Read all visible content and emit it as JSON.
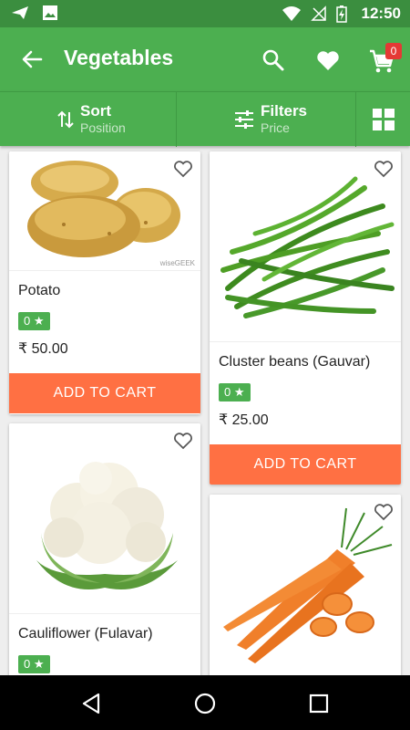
{
  "status_bar": {
    "time": "12:50"
  },
  "app_bar": {
    "title": "Vegetables",
    "cart_count": "0"
  },
  "filter_bar": {
    "sort": {
      "label": "Sort",
      "value": "Position"
    },
    "filters": {
      "label": "Filters",
      "value": "Price"
    }
  },
  "products": [
    {
      "name": "Potato",
      "rating": "0 ★",
      "price": "₹ 50.00",
      "add_label": "ADD TO CART",
      "watermark": "wiseGEEK"
    },
    {
      "name": "Cluster beans (Gauvar)",
      "rating": "0 ★",
      "price": "₹ 25.00",
      "add_label": "ADD TO CART"
    },
    {
      "name": "Cauliflower (Fulavar)",
      "rating": "0 ★"
    },
    {
      "name": ""
    }
  ],
  "colors": {
    "primary": "#4caf50",
    "primary_dark": "#3b8e3f",
    "accent": "#ff7043",
    "badge": "#e53935"
  }
}
